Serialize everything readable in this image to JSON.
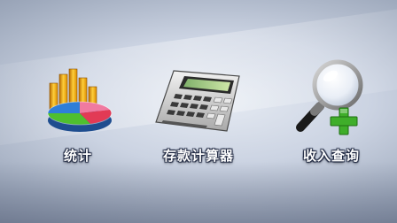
{
  "menu": {
    "items": [
      {
        "label": "统计",
        "icon": "statistics-chart-icon"
      },
      {
        "label": "存款计算器",
        "icon": "calculator-icon"
      },
      {
        "label": "收入查询",
        "icon": "magnifier-plus-icon"
      }
    ]
  },
  "colors": {
    "background_center": "#e6ebf3",
    "background_edge": "#6f7a91",
    "label_text": "#ffffff",
    "label_outline": "#1e2740",
    "plus_green": "#3fae2a"
  }
}
